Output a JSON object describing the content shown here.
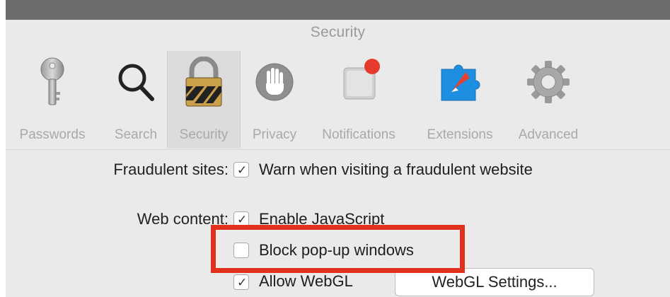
{
  "window": {
    "title": "Security"
  },
  "toolbar": {
    "items": [
      {
        "label": "Passwords",
        "icon": "key-icon"
      },
      {
        "label": "Search",
        "icon": "magnifier-icon"
      },
      {
        "label": "Security",
        "icon": "padlock-icon",
        "selected": true
      },
      {
        "label": "Privacy",
        "icon": "hand-icon"
      },
      {
        "label": "Notifications",
        "icon": "notification-badge-icon"
      },
      {
        "label": "Extensions",
        "icon": "puzzle-compass-icon"
      },
      {
        "label": "Advanced",
        "icon": "gear-icon"
      }
    ]
  },
  "security": {
    "fraudulent_label": "Fraudulent sites:",
    "fraudulent_option": {
      "text": "Warn when visiting a fraudulent website",
      "checked": true
    },
    "web_content_label": "Web content:",
    "javascript_option": {
      "text": "Enable JavaScript",
      "checked": true
    },
    "popup_option": {
      "text": "Block pop-up windows",
      "checked": false
    },
    "webgl_option": {
      "text": "Allow WebGL",
      "checked": true
    },
    "webgl_settings_button": "WebGL Settings..."
  },
  "colors": {
    "highlight": "#e2301f",
    "notification_badge": "#e53b2c",
    "window_bg": "#eaeaea"
  }
}
